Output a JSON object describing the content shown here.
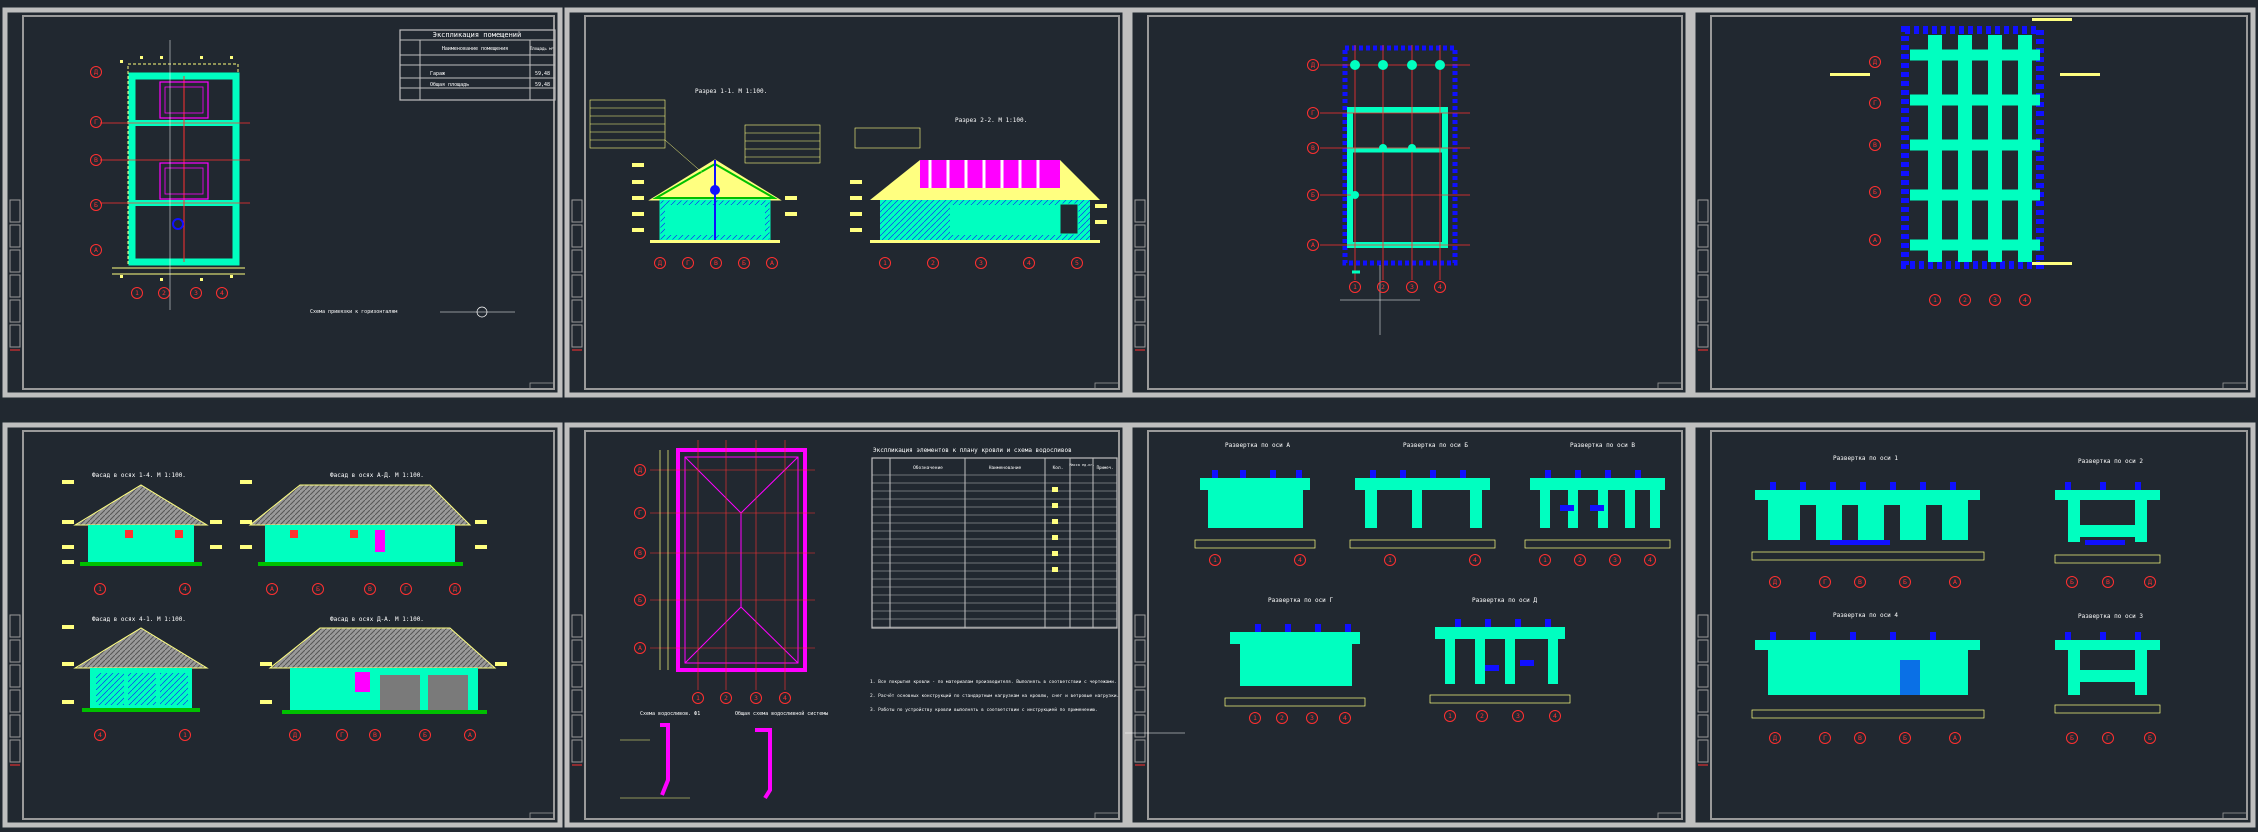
{
  "drawing": {
    "colors": {
      "background": "#212830",
      "frame": "#bfbfbf",
      "cyan": "#00ffc0",
      "blue": "#1010ff",
      "magenta": "#ff00ff",
      "yellow": "#ffff80",
      "red": "#ff3030",
      "green": "#00c000",
      "roof": "#8a8a8a"
    },
    "sheet1": {
      "table_title": "Экспликация помещений",
      "table_header_name": "Наименование помещения",
      "table_header_area": "Площадь м²",
      "row1_name": "Гараж",
      "row1_area": "59,48",
      "row2_name": "Общая площадь",
      "row2_area": "59,48",
      "note": "Схема привязки к горизонталям",
      "axes_bottom": [
        "1",
        "2",
        "3",
        "4"
      ],
      "axes_left": [
        "Д",
        "Г",
        "В",
        "Б",
        "А"
      ]
    },
    "sheet2": {
      "section1_title": "Разрез 1-1. М 1:100.",
      "section2_title": "Разрез 2-2. М 1:100."
    },
    "sheet3": {
      "axes_bottom": [
        "1",
        "2",
        "3",
        "4"
      ],
      "axes_left": [
        "Д",
        "Г",
        "В",
        "Б",
        "А"
      ]
    },
    "sheet4": {
      "axes_bottom": [
        "1",
        "2",
        "3",
        "4"
      ],
      "axes_left": [
        "Д",
        "Г",
        "В",
        "Б",
        "А"
      ]
    },
    "sheet5": {
      "facade1_title": "Фасад в осях 1-4. М 1:100.",
      "facade2_title": "Фасад в осях А-Д. М 1:100.",
      "facade3_title": "Фасад в осях 4-1. М 1:100.",
      "facade4_title": "Фасад в осях Д-А. М 1:100."
    },
    "sheet6": {
      "table_title": "Экспликация элементов к плану кровли и схема водосливов",
      "col1": "Обозначение",
      "col2": "Наименование",
      "col3": "Кол.",
      "col4": "Масса ед.кг.",
      "col5": "Примеч.",
      "detail1_title": "Схема водосливов. Ф1",
      "detail2_title": "Общая схема водосливной системы",
      "notes": [
        "1. Все покрытия кровли - по материалам производителя. Выполнять в соответствии с чертежами.",
        "2. Расчёт основных конструкций по стандартным нагрузкам на кровлю, снег и ветровые нагрузки.",
        "3. Работы по устройству кровли выполнять в соответствии с инструкцией по применению."
      ]
    },
    "sheet7": {
      "title_a": "Развертка по оси А",
      "title_b": "Развертка по оси Б",
      "title_v": "Развертка по оси В",
      "title_g": "Развертка по оси Г",
      "title_d": "Развертка по оси Д"
    },
    "sheet8": {
      "title_1": "Развертка по оси 1",
      "title_2": "Развертка по оси 2",
      "title_3": "Развертка по оси 3",
      "title_4": "Развертка по оси 4"
    }
  }
}
